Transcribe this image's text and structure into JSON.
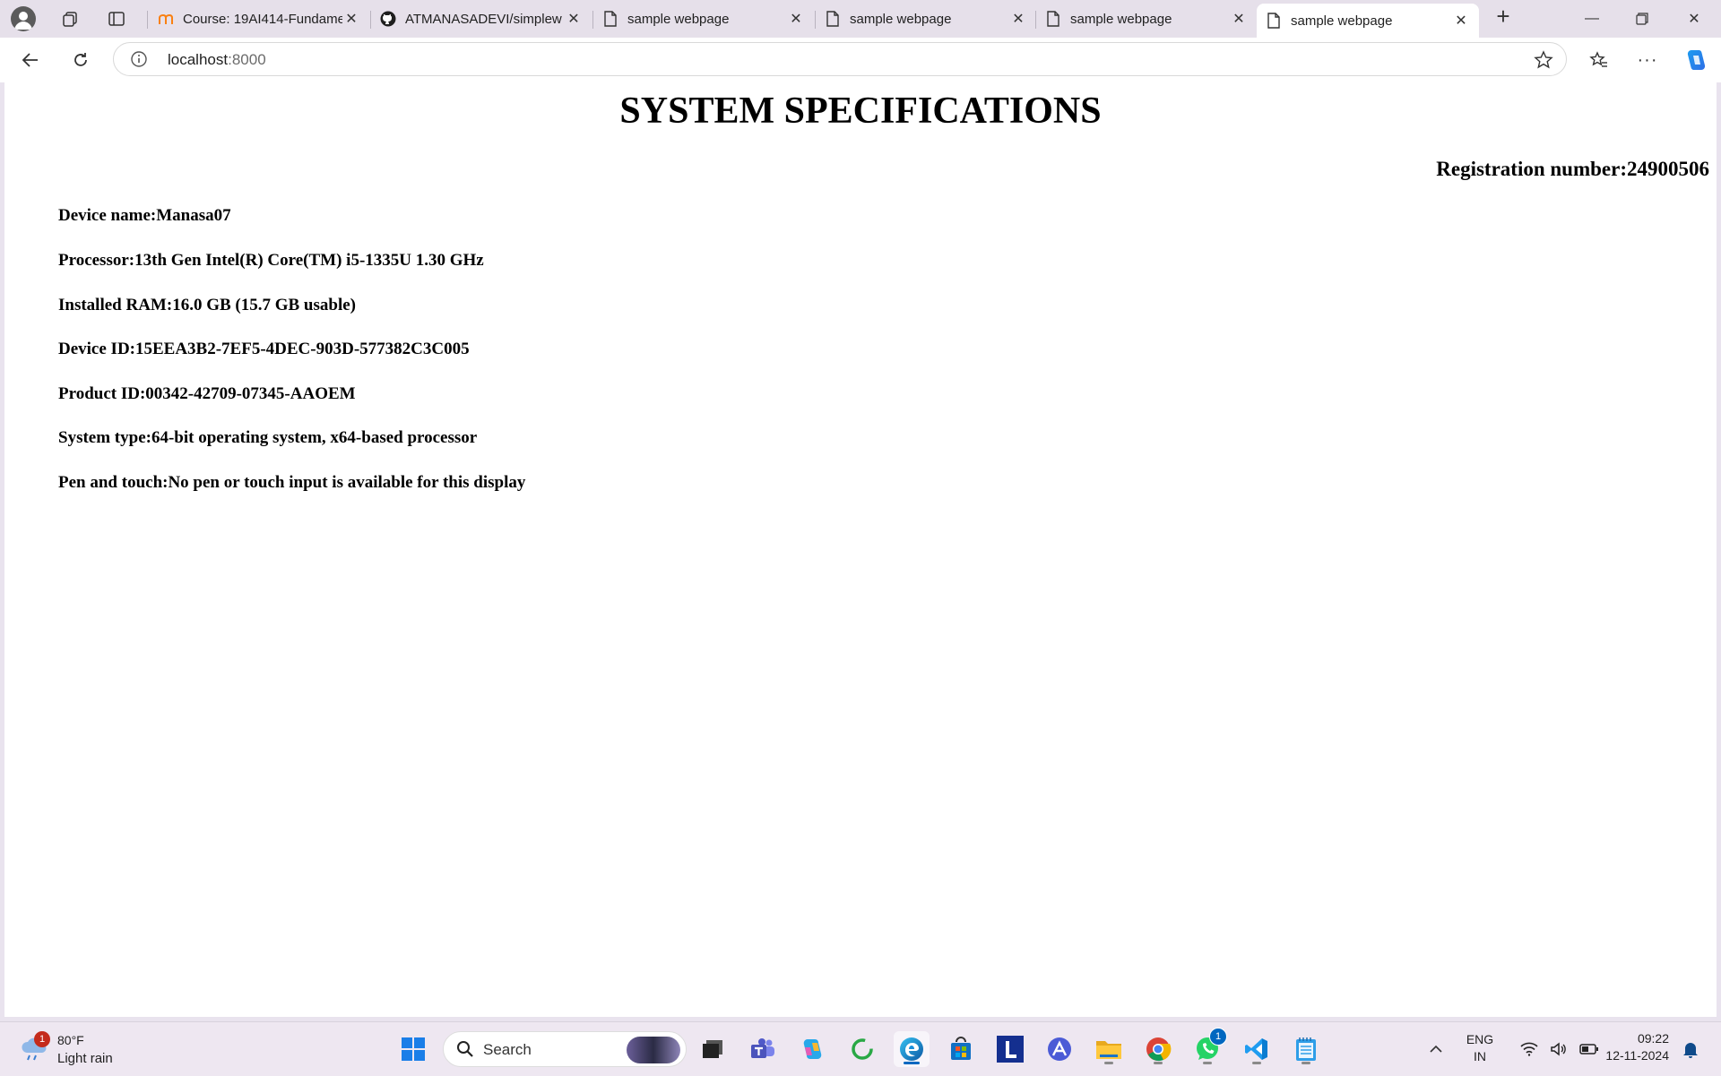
{
  "browser": {
    "tabs": [
      {
        "title": "Course: 19AI414-Fundame",
        "favicon": "moodle-icon",
        "active": false
      },
      {
        "title": "ATMANASADEVI/simplew",
        "favicon": "github-icon",
        "active": false
      },
      {
        "title": "sample webpage",
        "favicon": "page-icon",
        "active": false
      },
      {
        "title": "sample webpage",
        "favicon": "page-icon",
        "active": false
      },
      {
        "title": "sample webpage",
        "favicon": "page-icon",
        "active": false
      },
      {
        "title": "sample webpage",
        "favicon": "page-icon",
        "active": true
      }
    ],
    "address": {
      "host": "localhost",
      "port": ":8000"
    }
  },
  "page": {
    "title": "SYSTEM SPECIFICATIONS",
    "registration": "Registration number:24900506",
    "specs": [
      "Device name:Manasa07",
      "Processor:13th Gen Intel(R) Core(TM) i5-1335U 1.30 GHz",
      "Installed RAM:16.0 GB (15.7 GB usable)",
      "Device ID:15EEA3B2-7EF5-4DEC-903D-577382C3C005",
      "Product ID:00342-42709-07345-AAOEM",
      "System type:64-bit operating system, x64-based processor",
      "Pen and touch:No pen or touch input is available for this display"
    ]
  },
  "taskbar": {
    "weather": {
      "temp": "80°F",
      "condition": "Light rain",
      "badge": "1"
    },
    "search_placeholder": "Search",
    "whatsapp_badge": "1",
    "language": {
      "line1": "ENG",
      "line2": "IN"
    },
    "clock": {
      "time": "09:22",
      "date": "12-11-2024"
    }
  },
  "colors": {
    "accent": "#0067c0",
    "tabstrip": "#e6e0ea",
    "taskbar": "#eee7f1"
  }
}
